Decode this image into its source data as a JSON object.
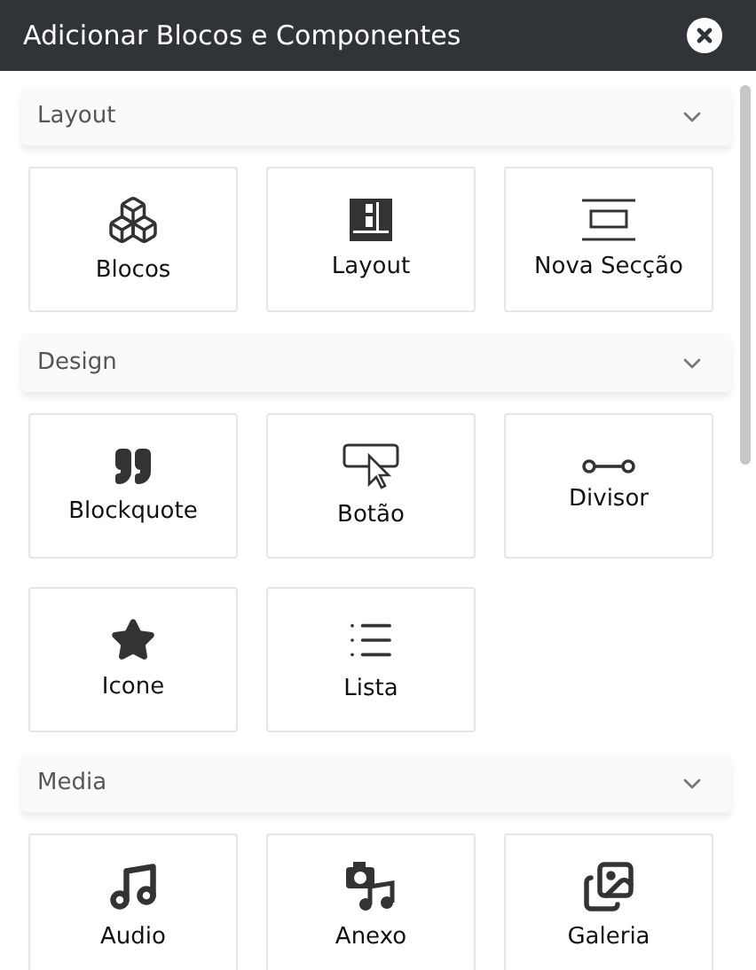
{
  "window": {
    "title": "Adicionar Blocos e Componentes"
  },
  "sections": [
    {
      "title": "Layout",
      "expanded": true,
      "items": [
        {
          "label": "Blocos",
          "kind": "blocks"
        },
        {
          "label": "Layout",
          "kind": "layout"
        },
        {
          "label": "Nova Secção",
          "kind": "section"
        }
      ]
    },
    {
      "title": "Design",
      "expanded": true,
      "items": [
        {
          "label": "Blockquote",
          "kind": "quote"
        },
        {
          "label": "Botão",
          "kind": "button"
        },
        {
          "label": "Divisor",
          "kind": "divider"
        },
        {
          "label": "Icone",
          "kind": "star"
        },
        {
          "label": "Lista",
          "kind": "list"
        }
      ]
    },
    {
      "title": "Media",
      "expanded": true,
      "items": [
        {
          "label": "Audio",
          "kind": "audio"
        },
        {
          "label": "Anexo",
          "kind": "attachment"
        },
        {
          "label": "Galeria",
          "kind": "gallery"
        }
      ]
    }
  ]
}
